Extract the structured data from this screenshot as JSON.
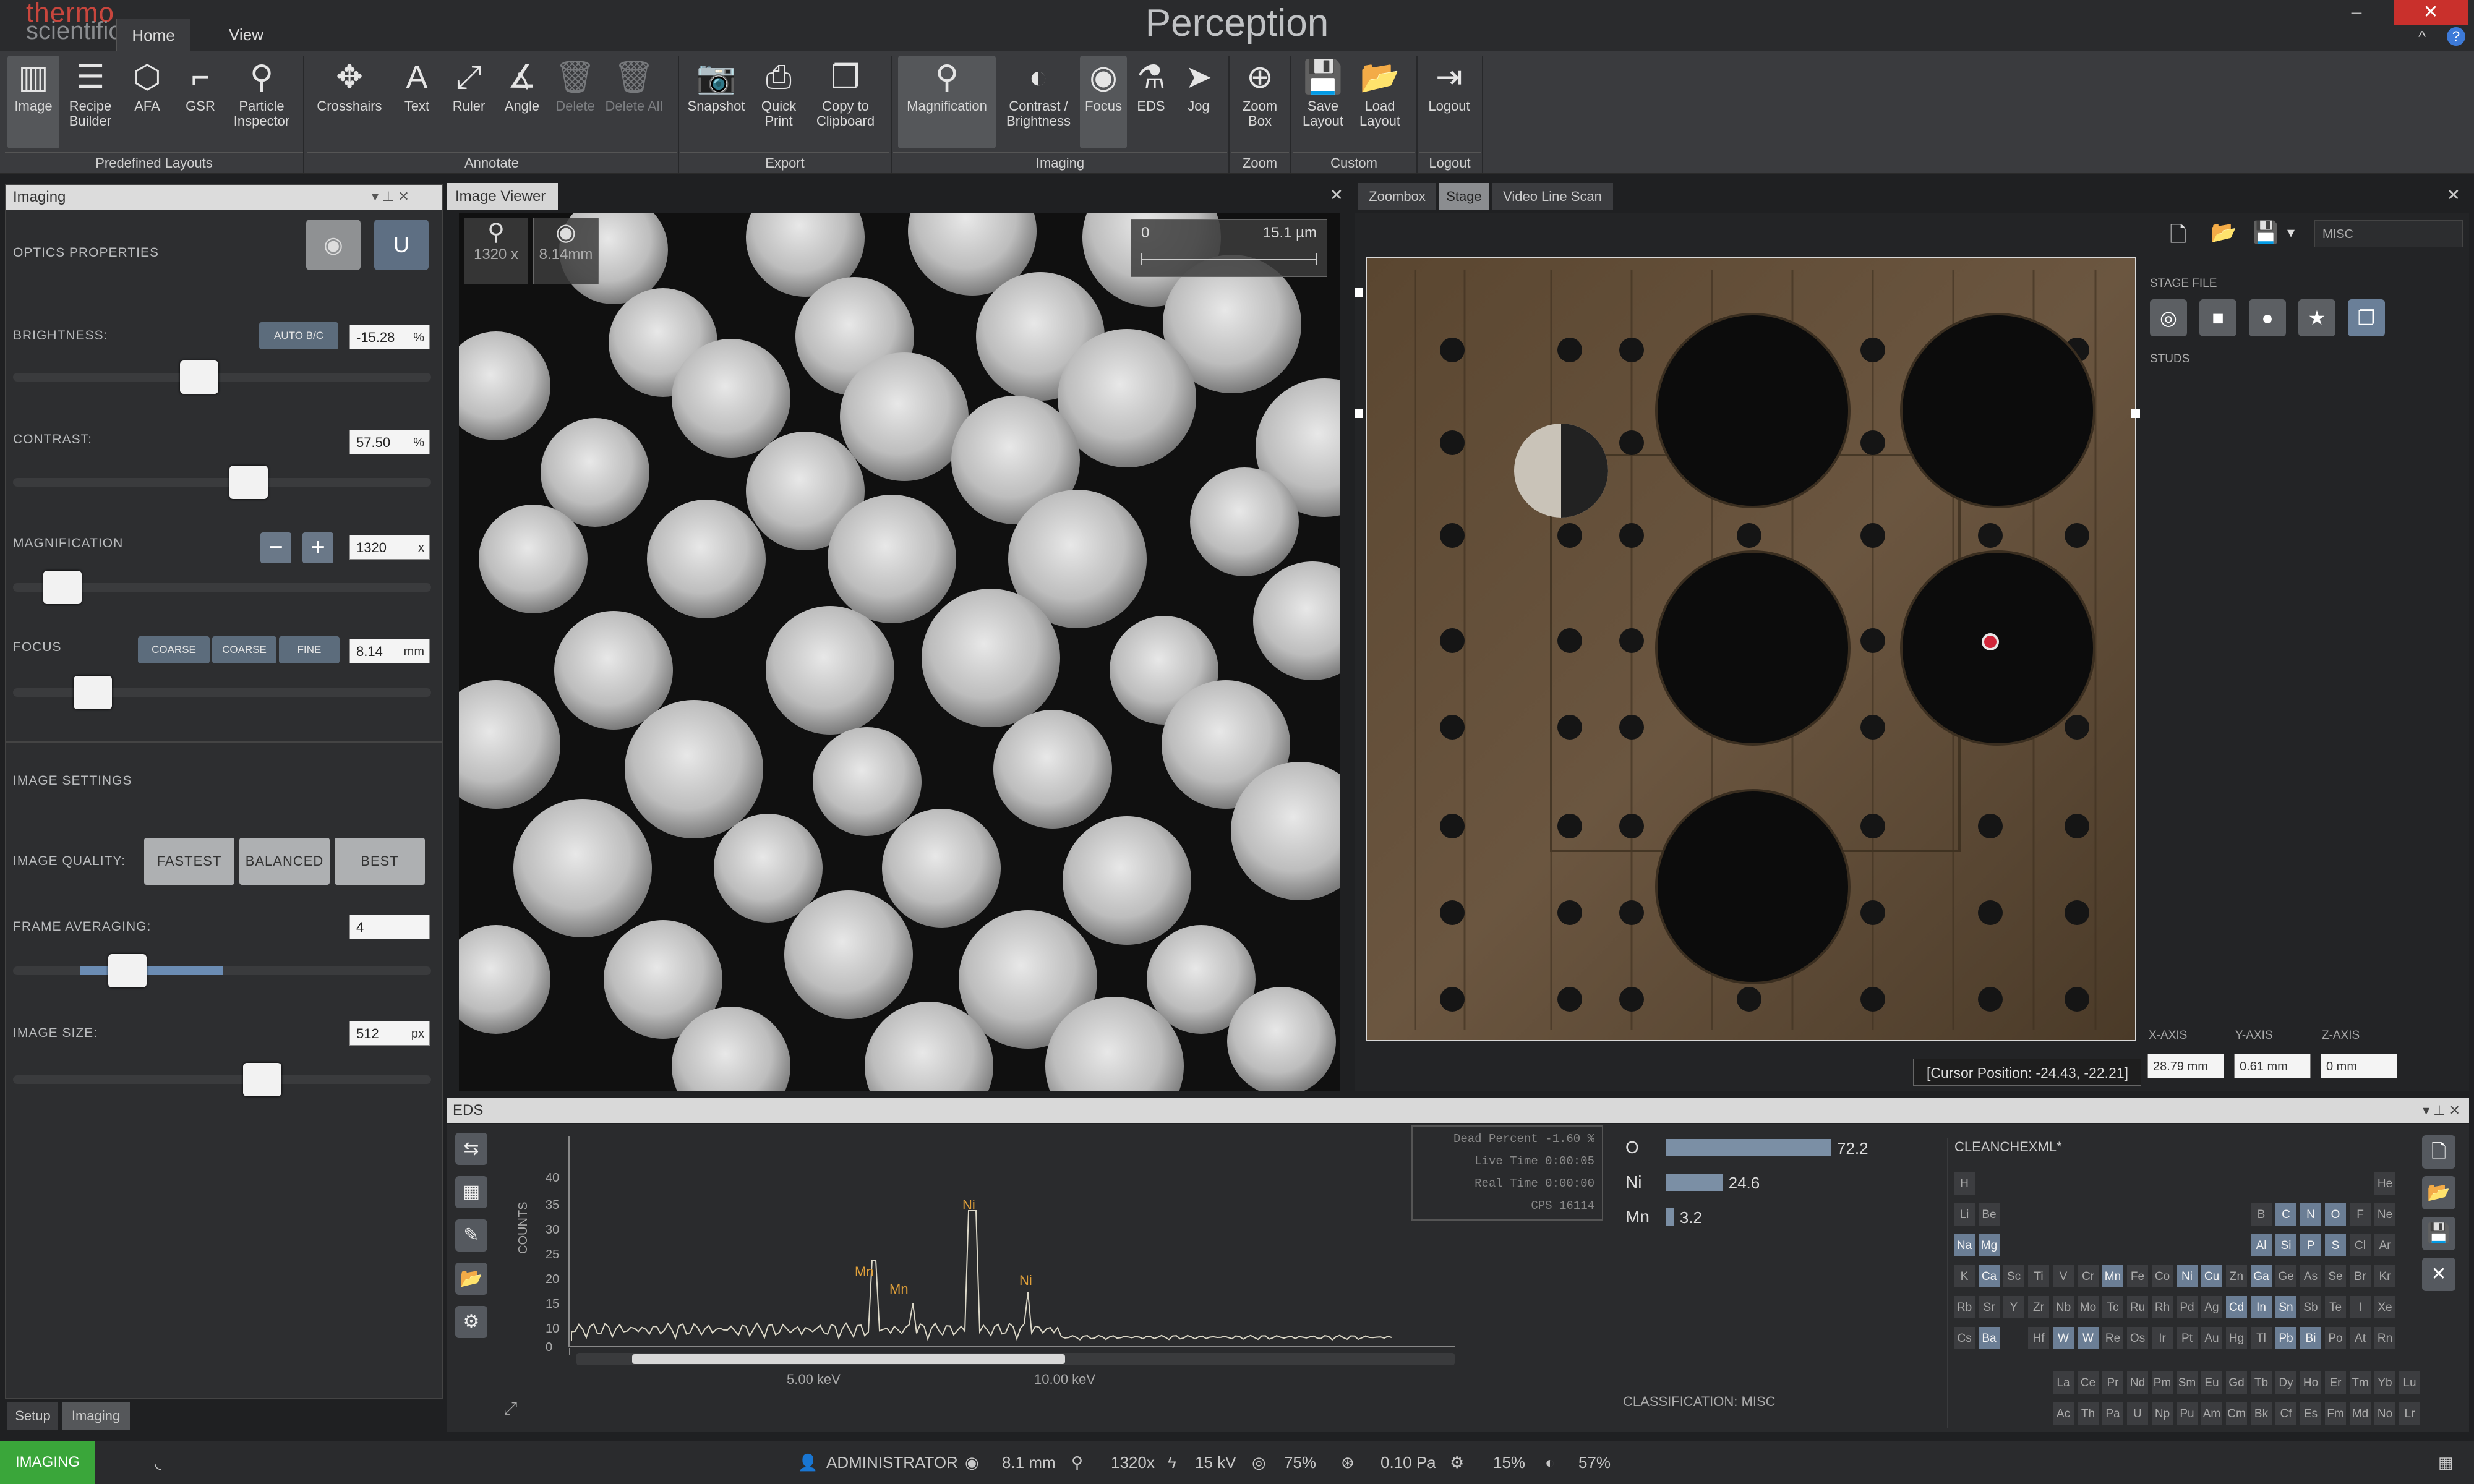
{
  "brand": {
    "line1": "thermo",
    "line2": "scientific"
  },
  "window": {
    "title": "Perception",
    "tabs": [
      "Home",
      "View"
    ]
  },
  "ribbon": {
    "buttons": [
      {
        "label": "Image",
        "icon": "layout-icon"
      },
      {
        "label": "Recipe Builder",
        "icon": "recipe-icon"
      },
      {
        "label": "AFA",
        "icon": "afa-icon"
      },
      {
        "label": "GSR",
        "icon": "gsr-icon"
      },
      {
        "label": "Particle Inspector",
        "icon": "particle-icon"
      },
      {
        "label": "Crosshairs",
        "icon": "crosshairs-icon"
      },
      {
        "label": "Text",
        "icon": "text-icon"
      },
      {
        "label": "Ruler",
        "icon": "ruler-icon"
      },
      {
        "label": "Angle",
        "icon": "angle-icon"
      },
      {
        "label": "Delete",
        "icon": "delete-icon"
      },
      {
        "label": "Delete All",
        "icon": "delete-all-icon"
      },
      {
        "label": "Snapshot",
        "icon": "camera-icon"
      },
      {
        "label": "Quick Print",
        "icon": "print-icon"
      },
      {
        "label": "Copy to Clipboard",
        "icon": "clipboard-icon"
      },
      {
        "label": "Magnification",
        "icon": "magnify-icon"
      },
      {
        "label": "Contrast / Brightness",
        "icon": "contrast-icon"
      },
      {
        "label": "Focus",
        "icon": "eye-icon"
      },
      {
        "label": "EDS",
        "icon": "flask-icon"
      },
      {
        "label": "Jog",
        "icon": "jog-icon"
      },
      {
        "label": "Zoom Box",
        "icon": "zoom-icon"
      },
      {
        "label": "Save Layout",
        "icon": "save-icon"
      },
      {
        "label": "Load Layout",
        "icon": "folder-icon"
      },
      {
        "label": "Logout",
        "icon": "logout-icon"
      }
    ],
    "groups": [
      "Predefined Layouts",
      "Annotate",
      "Export",
      "Imaging",
      "Zoom",
      "Custom",
      "Logout"
    ]
  },
  "imaging": {
    "panel_title": "Imaging",
    "optics_heading": "OPTICS PROPERTIES",
    "brightness": {
      "label": "BRIGHTNESS:",
      "button": "AUTO B/C",
      "value": "-15.28",
      "unit": "%",
      "level": 0.44
    },
    "contrast": {
      "label": "CONTRAST:",
      "value": "57.50",
      "unit": "%",
      "level": 0.57
    },
    "magnification": {
      "label": "MAGNIFICATION",
      "value": "1320",
      "unit": "x",
      "level": 0.08
    },
    "focus": {
      "label": "FOCUS",
      "buttons": [
        "COARSE",
        "COARSE",
        "FINE"
      ],
      "value": "8.14",
      "unit": "mm",
      "level": 0.16
    },
    "settings_heading": "IMAGE SETTINGS",
    "quality": {
      "label": "IMAGE QUALITY:",
      "options": [
        "FASTEST",
        "BALANCED",
        "BEST"
      ]
    },
    "frame_avg": {
      "label": "FRAME AVERAGING:",
      "value": "4"
    },
    "image_size": {
      "label": "IMAGE SIZE:",
      "value": "512",
      "unit": "px"
    },
    "bottom_tabs": [
      "Setup",
      "Imaging"
    ]
  },
  "viewer": {
    "tab": "Image Viewer",
    "mag_readout": "1320 x",
    "focus_readout": "8.14mm",
    "scale_start": "0",
    "scale_end": "15.1 µm"
  },
  "stage": {
    "tabs": [
      "Zoombox",
      "Stage",
      "Video Line Scan"
    ],
    "cursor_position": "[Cursor Position: -24.43, -22.21]",
    "stage_file_label": "STAGE FILE",
    "studs_label": "STUDS",
    "file_name": "MISC",
    "axes": [
      {
        "label": "X-AXIS",
        "value": "28.79 mm"
      },
      {
        "label": "Y-AXIS",
        "value": "0.61 mm"
      },
      {
        "label": "Z-AXIS",
        "value": "0 mm"
      }
    ]
  },
  "eds": {
    "title": "EDS",
    "acquisition": [
      {
        "label": "Dead Percent",
        "value": "-1.60 %"
      },
      {
        "label": "Live Time",
        "value": "0:00:05"
      },
      {
        "label": "Real Time",
        "value": "0:00:00"
      },
      {
        "label": "CPS",
        "value": "16114"
      }
    ],
    "composition": [
      {
        "element": "O",
        "value": 72.2
      },
      {
        "element": "Ni",
        "value": 24.6
      },
      {
        "element": "Mn",
        "value": 3.2
      }
    ],
    "classification_label": "CLASSIFICATION:",
    "classification_value": "MISC",
    "elements_title": "CLEANCHEXML*",
    "spectrum": {
      "ylabel": "COUNTS",
      "yticks": [
        "40",
        "35",
        "30",
        "25",
        "20",
        "15",
        "10",
        "0"
      ],
      "xlabels": [
        "5.00 keV",
        "10.00 keV"
      ],
      "peaks": [
        "Mn",
        "Mn",
        "Ni",
        "Ni"
      ]
    }
  },
  "periodic_rows": [
    [
      "H",
      "",
      "",
      "",
      "",
      "",
      "",
      "",
      "",
      "",
      "",
      "",
      "",
      "",
      "",
      "",
      "",
      "He"
    ],
    [
      "Li",
      "Be",
      "",
      "",
      "",
      "",
      "",
      "",
      "",
      "",
      "",
      "",
      "B",
      "C",
      "N",
      "O",
      "F",
      "Ne"
    ],
    [
      "Na",
      "Mg",
      "",
      "",
      "",
      "",
      "",
      "",
      "",
      "",
      "",
      "",
      "Al",
      "Si",
      "P",
      "S",
      "Cl",
      "Ar"
    ],
    [
      "K",
      "Ca",
      "Sc",
      "Ti",
      "V",
      "Cr",
      "Mn",
      "Fe",
      "Co",
      "Ni",
      "Cu",
      "Zn",
      "Ga",
      "Ge",
      "As",
      "Se",
      "Br",
      "Kr"
    ],
    [
      "Rb",
      "Sr",
      "Y",
      "Zr",
      "Nb",
      "Mo",
      "Tc",
      "Ru",
      "Rh",
      "Pd",
      "Ag",
      "Cd",
      "In",
      "Sn",
      "Sb",
      "Te",
      "I",
      "Xe"
    ],
    [
      "Cs",
      "Ba",
      "",
      "Hf",
      "W",
      "W",
      "Re",
      "Os",
      "Ir",
      "Pt",
      "Au",
      "Hg",
      "Tl",
      "Pb",
      "Bi",
      "Po",
      "At",
      "Rn"
    ],
    [
      "",
      "",
      "",
      "",
      "La",
      "Ce",
      "Pr",
      "Nd",
      "Pm",
      "Sm",
      "Eu",
      "Gd",
      "Tb",
      "Dy",
      "Ho",
      "Er",
      "Tm",
      "Yb",
      "Lu"
    ],
    [
      "",
      "",
      "",
      "",
      "Ac",
      "Th",
      "Pa",
      "U",
      "Np",
      "Pu",
      "Am",
      "Cm",
      "Bk",
      "Cf",
      "Es",
      "Fm",
      "Md",
      "No",
      "Lr"
    ]
  ],
  "status": {
    "mode": "IMAGING",
    "user": "ADMINISTRATOR",
    "focus": "8.1 mm",
    "mag": "1320x",
    "kv": "15 kV",
    "p1": "75%",
    "p2": "0.10 Pa",
    "p3": "15%",
    "p4": "57%"
  }
}
